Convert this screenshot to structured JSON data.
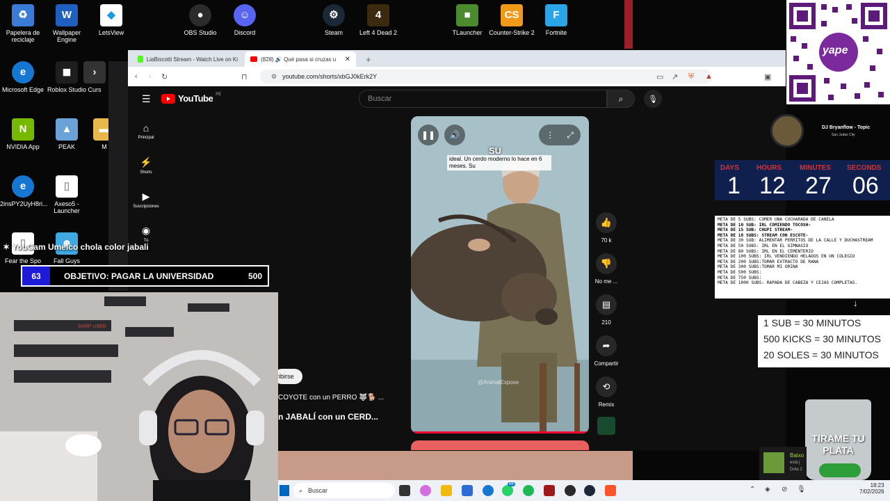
{
  "desktop": {
    "icons": [
      {
        "label": "Papelera de reciclaje",
        "icon": "recycle-bin-icon",
        "color": "#3a7bd5"
      },
      {
        "label": "Wallpaper Engine",
        "icon": "wallpaper-engine-icon",
        "color": "#1f5fbf"
      },
      {
        "label": "LetsView",
        "icon": "letsview-icon",
        "color": "#ffffff"
      },
      {
        "label": "OBS Studio",
        "icon": "obs-icon",
        "color": "#2b2b2b"
      },
      {
        "label": "Discord",
        "icon": "discord-icon",
        "color": "#5865f2"
      },
      {
        "label": "Steam",
        "icon": "steam-icon",
        "color": "#1b2838"
      },
      {
        "label": "Left 4 Dead 2",
        "icon": "l4d2-icon",
        "color": "#3b2a10"
      },
      {
        "label": "TLauncher",
        "icon": "tlauncher-icon",
        "color": "#4c8a2e"
      },
      {
        "label": "Counter-Strike 2",
        "icon": "cs2-icon",
        "color": "#f09a1a"
      },
      {
        "label": "Fortnite",
        "icon": "fortnite-icon",
        "color": "#2aa5e8"
      },
      {
        "label": "Microsoft Edge",
        "icon": "edge-icon",
        "color": "#1677d2"
      },
      {
        "label": "Roblox Studio",
        "icon": "roblox-icon",
        "color": "#1e1e1e"
      },
      {
        "label": "Curs",
        "icon": "cursor-icon",
        "color": "#333333"
      },
      {
        "label": "NVIDIA App",
        "icon": "nvidia-icon",
        "color": "#76b900"
      },
      {
        "label": "PEAK",
        "icon": "peak-icon",
        "color": "#6ba3d8"
      },
      {
        "label": "M",
        "icon": "folder-icon",
        "color": "#e8b84a"
      },
      {
        "label": "2insPY2UyH8ri...",
        "icon": "edge-icon",
        "color": "#1677d2"
      },
      {
        "label": "Axeso5 - Launcher",
        "icon": "file-icon",
        "color": "#ffffff"
      },
      {
        "label": "Fear the Spo",
        "icon": "file-icon",
        "color": "#ffffff"
      },
      {
        "label": "Fall Guys",
        "icon": "fallguys-icon",
        "color": "#3fa8e0"
      }
    ]
  },
  "browser": {
    "tabs": [
      {
        "title": "LiaBiscotti Stream - Watch Live on Ki",
        "icon": "kick-icon"
      },
      {
        "title": "(828) 🔊 Qué pasa si cruzas u",
        "icon": "youtube-icon"
      }
    ],
    "new_tab": "+",
    "url": "youtube.com/shorts/xbGJ0kErk2Y"
  },
  "youtube": {
    "brand": "YouTube",
    "region": "PE",
    "search_placeholder": "Buscar",
    "nav": [
      {
        "label": "Principal",
        "icon": "home-icon"
      },
      {
        "label": "Shorts",
        "icon": "shorts-icon"
      },
      {
        "label": "Suscripciones",
        "icon": "subscriptions-icon"
      },
      {
        "label": "Tú",
        "icon": "user-icon"
      }
    ],
    "short": {
      "caption_word": "SU",
      "caption_text": "ideal. Un cerdo moderno lo hace en 6 meses. Su",
      "watermark": "@AnimalExpose"
    },
    "actions": [
      {
        "label": "70 k",
        "icon": "thumbs-up-icon"
      },
      {
        "label": "No me ...",
        "icon": "thumbs-down-icon"
      },
      {
        "label": "210",
        "icon": "comment-icon"
      },
      {
        "label": "Compartir",
        "icon": "share-icon"
      },
      {
        "label": "Remix",
        "icon": "remix-icon"
      }
    ],
    "subscribe_label": "ribirse",
    "suggestions": [
      "COYOTE con un PERRO 🐺🐕 ...",
      "n JABALÍ con un CERD..."
    ]
  },
  "stream": {
    "alert": "YouGam Umelco chola color jabali",
    "goal": {
      "current": "63",
      "label": "OBJETIVO: PAGAR LA UNIVERSIDAD",
      "target": "500"
    },
    "webcam_tag": "SHRP USER",
    "now_playing": {
      "title": "DJ Bryanflow - Topic",
      "subtitle": "San Judas City"
    },
    "countdown": {
      "labels": [
        "DAYS",
        "HOURS",
        "MINUTES",
        "SECONDS"
      ],
      "values": [
        "1",
        "12",
        "27",
        "06"
      ]
    },
    "meta_goals": [
      {
        "text": "META DE 5 SUBS: COMER UNA CUCHARADA DE CANELA",
        "bold": false
      },
      {
        "text": "META DE 10 SUB: IRL COMIENDO TOCOSH-",
        "bold": true
      },
      {
        "text": "META DE 15 SUB: CHUPI STREAM-",
        "bold": true
      },
      {
        "text": "META DE 18 SUBS: STREAM CON ESCOTE-",
        "bold": true
      },
      {
        "text": "META DE 30 SUB:  ALIMENTAR PERRITOS DE LA CALLE Y DUCHASTREAM",
        "bold": false
      },
      {
        "text": "META DE 50 SUBS: IRL EN EL GIMNASIO",
        "bold": false
      },
      {
        "text": "META DE 80 SUBS: IRL EN EL CEMENTERIO",
        "bold": false
      },
      {
        "text": "META DE 100 SUBS: IRL VENDIENDO HELADOS EN UN COLEGIO",
        "bold": false
      },
      {
        "text": "META DE 200 SUBS:TOMAR EXTRACTO DE RANA",
        "bold": false
      },
      {
        "text": "META DE 300 SUBS:TOMAR MI ORINA",
        "bold": false
      },
      {
        "text": "META DE 500 SUBS:",
        "bold": false
      },
      {
        "text": "META DE 750 SUBS:",
        "bold": false
      },
      {
        "text": "META DE 1000 SUBS: RAPADA DE CABEZA Y CEJAS COMPLETAS.",
        "bold": false
      }
    ],
    "time_rules": [
      "1 SUB = 30 MINUTOS",
      "500 KICKS = 30 MINUTOS",
      "20 SOLES = 30 MINUTOS"
    ],
    "tip_jar": "TIRAME TU PLATA",
    "qr_brand": "yape",
    "notification": {
      "title": "Baixo",
      "line1": "está j",
      "line2": "Dota 2"
    }
  },
  "taskbar": {
    "search_placeholder": "Buscar",
    "badge": "68",
    "time": "18:23",
    "date": "7/02/2026"
  },
  "colors": {
    "youtube_red": "#ff0000",
    "goal_blue": "#1d1ad8",
    "countdown_bg": "#10204e",
    "countdown_label": "#d93030"
  }
}
